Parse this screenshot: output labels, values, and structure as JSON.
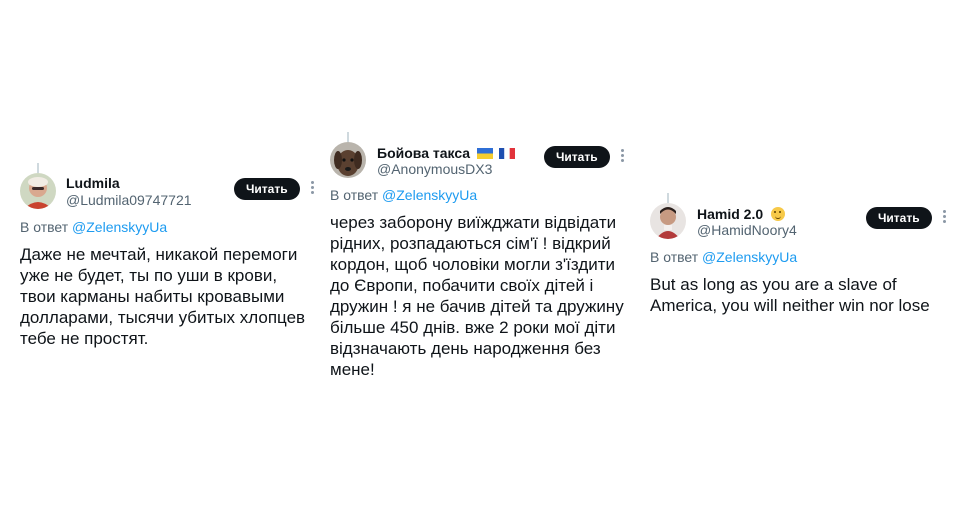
{
  "tweets": [
    {
      "name": "Ludmila",
      "handle": "@Ludmila09747721",
      "follow_label": "Читать",
      "reply_prefix": "В ответ",
      "reply_mention": "@ZelenskyyUa",
      "lines": [
        "Даже не мечтай, никакой перемоги",
        "уже не будет, ты по уши в крови,",
        "твои карманы набиты кровавыми",
        "долларами, тысячи убитых хлопцев",
        "тебе не простят."
      ]
    },
    {
      "name": "Бойова такса",
      "name_emojis": [
        "ukraine-flag",
        "france-flag"
      ],
      "handle": "@AnonymousDX3",
      "follow_label": "Читать",
      "reply_prefix": "В ответ",
      "reply_mention": "@ZelenskyyUa",
      "lines": [
        "через заборону виїжджати відвідати",
        "рідних, розпадаються сім'ї ! відкрий",
        "кордон, щоб чоловіки могли з'їздити",
        "до Європи, побачити своїх дітей і",
        "дружин ! я не бачив дітей та дружину",
        "більше 450 днів. вже 2 роки мої діти",
        "відзначають день народження без",
        "мене!"
      ]
    },
    {
      "name": "Hamid 2.0",
      "name_emojis": [
        "hugging-face-emoji"
      ],
      "handle": "@HamidNoory4",
      "follow_label": "Читать",
      "reply_prefix": "В ответ",
      "reply_mention": "@ZelenskyyUa",
      "lines": [
        "But as long as you are a slave of",
        "America, you will neither win nor lose"
      ]
    }
  ],
  "colors": {
    "text": "#0f1419",
    "secondary": "#536471",
    "link": "#1d9bf0",
    "button_bg": "#0f1419",
    "button_text": "#ffffff"
  }
}
